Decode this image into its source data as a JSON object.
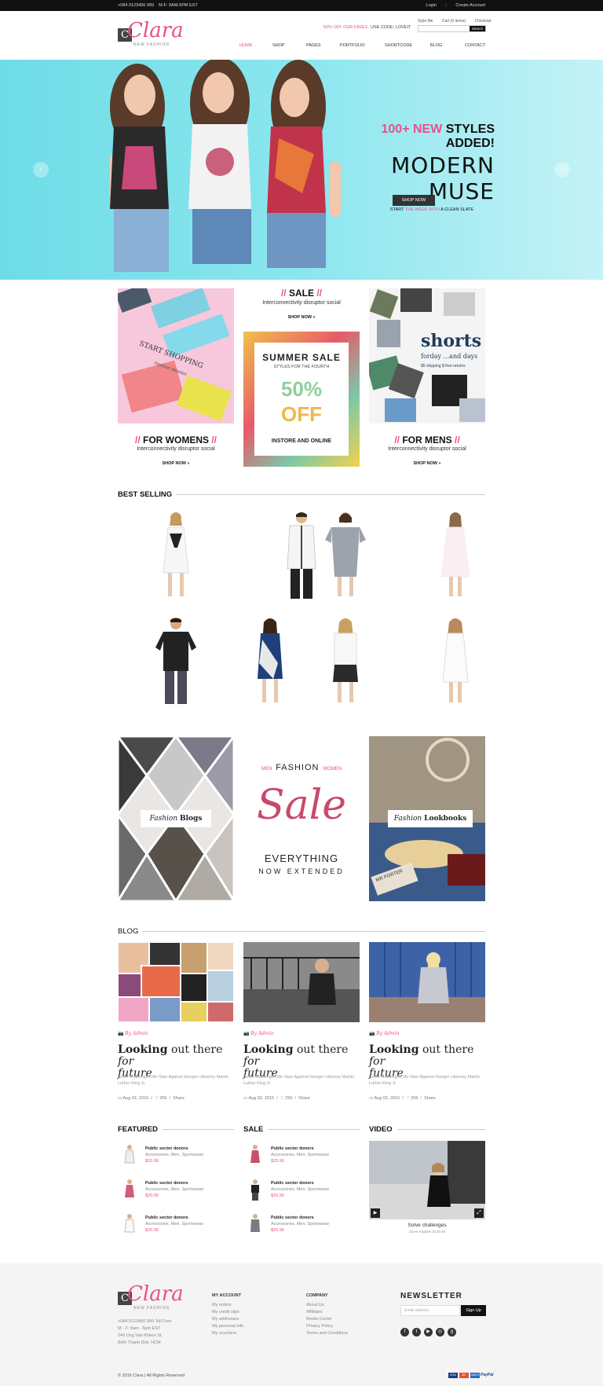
{
  "topbar": {
    "phone": "+084 0123456 999",
    "hours": "M-F: 9AM-5PM EST",
    "login": "Login",
    "create_account": "Create Account"
  },
  "header": {
    "logo_name": "Clara",
    "logo_tag": "NEW FASHION",
    "logo_letter": "C",
    "promo": "50% OFF OUR FAVES",
    "code": "USE CODE: LOVEIT",
    "style_me": "Style Me",
    "cart": "Cart (0 items)",
    "checkout": "Checkout",
    "search_button": "Search",
    "nav": [
      "HOME",
      "SHOP",
      "PAGES",
      "PORTFOLIO",
      "SHORTCODE",
      "BLOG",
      "CONTACT"
    ]
  },
  "hero": {
    "line1_accent": "100+ NEW",
    "line1": " STYLES ADDED!",
    "line2": "MODERN MUSE",
    "line3_a": "START ",
    "line3_accent": "THE WEEK WITH",
    "line3_b": " A CLEAN SLATE",
    "button": "SHOP NOW"
  },
  "banners": {
    "womens": {
      "img_text": "START SHOPPING",
      "img_sub": "Fashion Women",
      "title": "FOR WOMENS",
      "sub": "Interconnectivity disruptor social",
      "link": "SHOP NOW »"
    },
    "sale": {
      "title": "SALE",
      "sub": "Interconnectivity disruptor social",
      "link": "SHOP NOW »",
      "box_title": "SUMMER SALE",
      "box_sub": "STYLES FOR THE FOURTH",
      "box_pct": "50%",
      "box_off": "OFF",
      "box_foot": "INSTORE AND ONLINE"
    },
    "mens": {
      "img_title": "shorts",
      "img_sub": "forday ...and days",
      "img_note": "$5 shipping $ free returns",
      "title": "FOR MENS",
      "sub": "Interconnectivity disruptor social",
      "link": "SHOP NOW »"
    },
    "slashes": "//"
  },
  "best_selling": {
    "title": "BEST SELLING"
  },
  "promo_row": {
    "blogs_label": "Fashion Blogs",
    "blogs_a": "Fashion",
    "blogs_b": "Blogs",
    "men": "MEN",
    "fashion": "FASHION",
    "women": "WOMEN",
    "sale": "Sale",
    "everything": "EVERYTHING",
    "extended": "NOW EXTENDED",
    "look_a": "Fashion",
    "look_b": "Lookbooks",
    "mr_porter": "MR PORTER"
  },
  "blog": {
    "title": "BLOG",
    "posts": [
      {
        "author": "By Admin",
        "title_a": "Looking",
        "title_b": " out there ",
        "title_c": "for",
        "title_d": "future",
        "text": "Solve challenges life-Stan Against Hunger citizenry Martin Luther King Jr.",
        "date": "Aug 02, 2016",
        "likes": "259",
        "share": "Share"
      },
      {
        "author": "By Admin",
        "title_a": "Looking",
        "title_b": " out there ",
        "title_c": "for",
        "title_d": "future",
        "text": "Solve challenges life-Stan Against Hunger citizenry Martin Luther King Jr.",
        "date": "Aug 02, 2016",
        "likes": "259",
        "share": "Share"
      },
      {
        "author": "By Admin",
        "title_a": "Looking",
        "title_b": " out there ",
        "title_c": "for",
        "title_d": "future",
        "text": "Solve challenges life-Stan Against Hunger citizenry Martin Luther King Jr.",
        "date": "Aug 02, 2016",
        "likes": "259",
        "share": "Share"
      }
    ]
  },
  "featured": {
    "title": "FEATURED",
    "items": [
      {
        "name": "Public sector donors",
        "cat": "Accessories, Men, Sportswear",
        "price": "$20.99"
      },
      {
        "name": "Public sector donors",
        "cat": "Accessories, Men, Sportswear",
        "price": "$20.99"
      },
      {
        "name": "Public sector donors",
        "cat": "Accessories, Men, Sportswear",
        "price": "$20.99"
      }
    ]
  },
  "sale_list": {
    "title": "SALE",
    "items": [
      {
        "name": "Public sector donors",
        "cat": "Accessories, Men, Sportswear",
        "price": "$20.99"
      },
      {
        "name": "Public sector donors",
        "cat": "Accessories, Men, Sportswear",
        "price": "$20.99"
      },
      {
        "name": "Public sector donors",
        "cat": "Accessories, Men, Sportswear",
        "price": "$20.99"
      }
    ]
  },
  "video": {
    "title": "VIDEO",
    "caption": "Solve challenges",
    "sub": "Steve Hadden $129.99"
  },
  "footer": {
    "address": [
      "+084 0123456 999 Toll Free",
      "M - F: 9am - 5pm EST",
      "249 Ung Van Khiem St,",
      "Binh Thanh Dist, HCM"
    ],
    "account_title": "MY ACCOUNT",
    "account_links": [
      "My orders",
      "My credit slips",
      "My addresses",
      "My personal info",
      "My vouchers"
    ],
    "company_title": "COMPANY",
    "company_links": [
      "About Us",
      "Affiliates",
      "Media Center",
      "Privacy Policy",
      "Terms and Conditions"
    ],
    "newsletter_title": "NEWSLETTER",
    "email_placeholder": "Email address",
    "signup": "Sign Up",
    "copyright": "© 2016 Clara | All Rights Reserved",
    "payments": [
      "VISA",
      "MC",
      "AMEX",
      "PayPal"
    ]
  }
}
